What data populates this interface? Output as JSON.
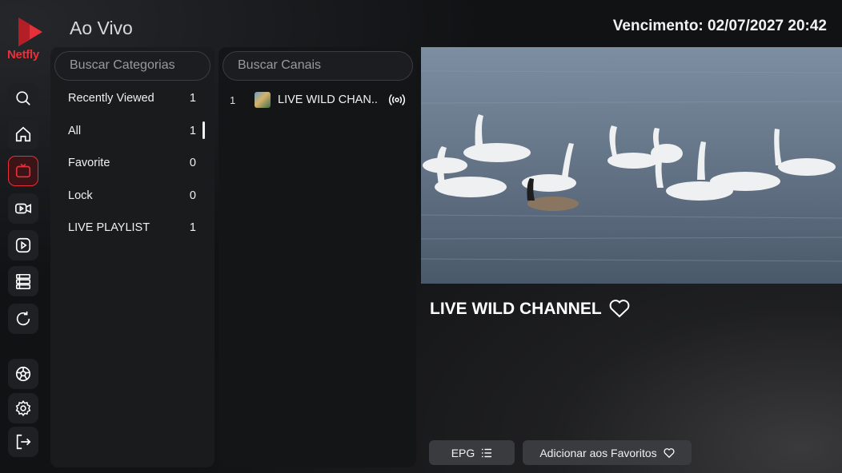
{
  "header": {
    "title": "Ao Vivo",
    "expiry": "Vencimento: 02/07/2027 20:42"
  },
  "brand": {
    "name": "Netfly",
    "color": "#e8303a"
  },
  "rail": {
    "items": [
      {
        "icon": "search-icon"
      },
      {
        "icon": "home-icon"
      },
      {
        "icon": "live-tv-icon",
        "active": true
      },
      {
        "icon": "movie-camera-icon"
      },
      {
        "icon": "play-icon"
      },
      {
        "icon": "series-list-icon"
      },
      {
        "icon": "refresh-icon"
      },
      {
        "icon": "football-icon"
      },
      {
        "icon": "gear-icon"
      },
      {
        "icon": "logout-icon"
      }
    ]
  },
  "categories": {
    "placeholder": "Buscar Categorias",
    "items": [
      {
        "label": "Recently Viewed",
        "count": "1"
      },
      {
        "label": "All",
        "count": "1"
      },
      {
        "label": "Favorite",
        "count": "0"
      },
      {
        "label": "Lock",
        "count": "0"
      },
      {
        "label": "LIVE PLAYLIST",
        "count": "1"
      }
    ]
  },
  "channels": {
    "placeholder": "Buscar Canais",
    "items": [
      {
        "number": "1",
        "name": "LIVE WILD CHAN.."
      }
    ]
  },
  "player": {
    "title": "LIVE WILD CHANNEL",
    "epg_label": "EPG",
    "favorite_label": "Adicionar aos Favoritos"
  }
}
